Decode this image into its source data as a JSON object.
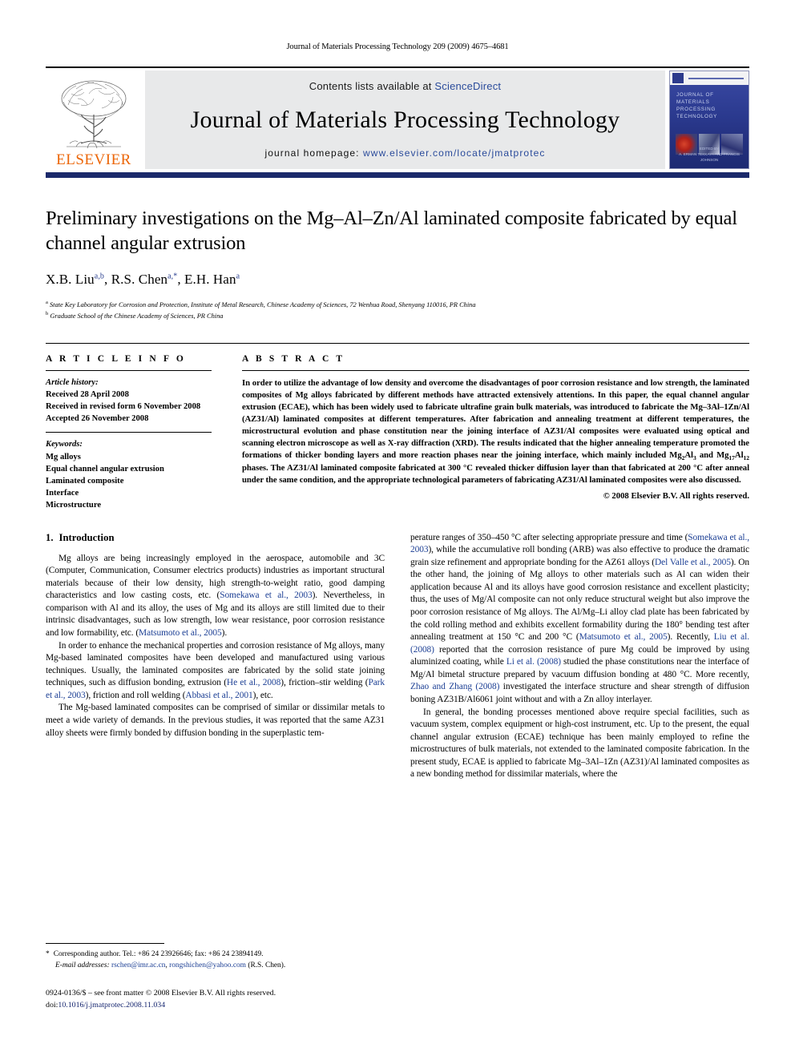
{
  "running_head": "Journal of Materials Processing Technology 209 (2009) 4675–4681",
  "masthead": {
    "publisher": "ELSEVIER",
    "contents_prefix": "Contents lists available at ",
    "contents_link": "ScienceDirect",
    "journal_title": "Journal of Materials Processing Technology",
    "homepage_prefix": "journal homepage:",
    "homepage_url": "www.elsevier.com/locate/jmatprotec",
    "cover": {
      "title_line1": "JOURNAL OF MATERIALS",
      "title_line2": "PROCESSING TECHNOLOGY",
      "footer_line1": "EDITED BY",
      "footer_line2": "A. ERMAN TEKKAYA AND FRANCIS JOHNSON"
    }
  },
  "article": {
    "title": "Preliminary investigations on the Mg–Al–Zn/Al laminated composite fabricated by equal channel angular extrusion",
    "authors": [
      {
        "name": "X.B. Liu",
        "sup": "a,b"
      },
      {
        "name": "R.S. Chen",
        "sup": "a,*"
      },
      {
        "name": "E.H. Han",
        "sup": "a"
      }
    ],
    "affiliations": [
      {
        "mark": "a",
        "text": "State Key Laboratory for Corrosion and Protection, Institute of Metal Research, Chinese Academy of Sciences, 72 Wenhua Road, Shenyang 110016, PR China"
      },
      {
        "mark": "b",
        "text": "Graduate School of the Chinese Academy of Sciences, PR China"
      }
    ]
  },
  "article_info": {
    "heading": "A R T I C L E   I N F O",
    "history_label": "Article history:",
    "history": [
      "Received 28 April 2008",
      "Received in revised form 6 November 2008",
      "Accepted 26 November 2008"
    ],
    "keywords_label": "Keywords:",
    "keywords": [
      "Mg alloys",
      "Equal channel angular extrusion",
      "Laminated composite",
      "Interface",
      "Microstructure"
    ]
  },
  "abstract": {
    "heading": "A B S T R A C T",
    "text_part1": "In order to utilize the advantage of low density and overcome the disadvantages of poor corrosion resistance and low strength, the laminated composites of Mg alloys fabricated by different methods have attracted extensively attentions. In this paper, the equal channel angular extrusion (ECAE), which has been widely used to fabricate ultrafine grain bulk materials, was introduced to fabricate the Mg–3Al–1Zn/Al (AZ31/Al) laminated composites at different temperatures. After fabrication and annealing treatment at different temperatures, the microstructural evolution and phase constitution near the joining interface of AZ31/Al composites were evaluated using optical and scanning electron microscope as well as X-ray diffraction (XRD). The results indicated that the higher annealing temperature promoted the formations of thicker bonding layers and more reaction phases near the joining interface, which mainly included ",
    "formula1_base": "Mg",
    "formula1_sub1": "2",
    "formula1_mid": "Al",
    "formula1_sub2": "3",
    "text_mid": " and ",
    "formula2_base": "Mg",
    "formula2_sub1": "17",
    "formula2_mid": "Al",
    "formula2_sub2": "12",
    "text_part2": " phases. The AZ31/Al laminated composite fabricated at 300 °C revealed thicker diffusion layer than that fabricated at 200 °C after anneal under the same condition, and the appropriate technological parameters of fabricating AZ31/Al laminated composites were also discussed.",
    "copyright": "© 2008 Elsevier B.V. All rights reserved."
  },
  "body": {
    "section_number": "1.",
    "section_title": "Introduction",
    "left_paragraphs": [
      {
        "segments": [
          {
            "t": "Mg alloys are being increasingly employed in the aerospace, automobile and 3C (Computer, Communication, Consumer electrics products) industries as important structural materials because of their low density, high strength-to-weight ratio, good damping characteristics and low casting costs, etc. ("
          },
          {
            "t": "Somekawa et al., 2003",
            "r": true
          },
          {
            "t": "). Nevertheless, in comparison with Al and its alloy, the uses of Mg and its alloys are still limited due to their intrinsic disadvantages, such as low strength, low wear resistance, poor corrosion resistance and low formability, etc. ("
          },
          {
            "t": "Matsumoto et al., 2005",
            "r": true
          },
          {
            "t": ")."
          }
        ]
      },
      {
        "segments": [
          {
            "t": "In order to enhance the mechanical properties and corrosion resistance of Mg alloys, many Mg-based laminated composites have been developed and manufactured using various techniques. Usually, the laminated composites are fabricated by the solid state joining techniques, such as diffusion bonding, extrusion ("
          },
          {
            "t": "He et al., 2008",
            "r": true
          },
          {
            "t": "), friction–stir welding ("
          },
          {
            "t": "Park et al., 2003",
            "r": true
          },
          {
            "t": "), friction and roll welding ("
          },
          {
            "t": "Abbasi et al., 2001",
            "r": true
          },
          {
            "t": "), etc."
          }
        ]
      },
      {
        "segments": [
          {
            "t": "The Mg-based laminated composites can be comprised of similar or dissimilar metals to meet a wide variety of demands. In the previous studies, it was reported that the same AZ31 alloy sheets were firmly bonded by diffusion bonding in the superplastic tem-"
          }
        ]
      }
    ],
    "right_paragraphs": [
      {
        "segments": [
          {
            "t": "perature ranges of 350–450 °C after selecting appropriate pressure and time ("
          },
          {
            "t": "Somekawa et al., 2003",
            "r": true
          },
          {
            "t": "), while the accumulative roll bonding (ARB) was also effective to produce the dramatic grain size refinement and appropriate bonding for the AZ61 alloys ("
          },
          {
            "t": "Del Valle et al., 2005",
            "r": true
          },
          {
            "t": "). On the other hand, the joining of Mg alloys to other materials such as Al can widen their application because Al and its alloys have good corrosion resistance and excellent plasticity; thus, the uses of Mg/Al composite can not only reduce structural weight but also improve the poor corrosion resistance of Mg alloys. The Al/Mg–Li alloy clad plate has been fabricated by the cold rolling method and exhibits excellent formability during the 180° bending test after annealing treatment at 150 °C and 200 °C ("
          },
          {
            "t": "Matsumoto et al., 2005",
            "r": true
          },
          {
            "t": "). Recently, "
          },
          {
            "t": "Liu et al. (2008)",
            "r": true
          },
          {
            "t": " reported that the corrosion resistance of pure Mg could be improved by using aluminized coating, while "
          },
          {
            "t": "Li et al. (2008)",
            "r": true
          },
          {
            "t": " studied the phase constitutions near the interface of Mg/Al bimetal structure prepared by vacuum diffusion bonding at 480 °C. More recently, "
          },
          {
            "t": "Zhao and Zhang (2008)",
            "r": true
          },
          {
            "t": " investigated the interface structure and shear strength of diffusion boning AZ31B/Al6061 joint without and with a Zn alloy interlayer."
          }
        ]
      },
      {
        "segments": [
          {
            "t": "In general, the bonding processes mentioned above require special facilities, such as vacuum system, complex equipment or high-cost instrument, etc. Up to the present, the equal channel angular extrusion (ECAE) technique has been mainly employed to refine the microstructures of bulk materials, not extended to the laminated composite fabrication. In the present study, ECAE is applied to fabricate Mg–3Al–1Zn (AZ31)/Al laminated composites as a new bonding method for dissimilar materials, where the"
          }
        ]
      }
    ]
  },
  "footnote": {
    "star": "*",
    "corresponding": "Corresponding author. Tel.: +86 24 23926646; fax: +86 24 23894149.",
    "email_label": "E-mail addresses:",
    "email1": "rschen@imr.ac.cn",
    "email_sep": ", ",
    "email2": "rongshichen@yahoo.com",
    "email_suffix": " (R.S. Chen)."
  },
  "footer": {
    "issn": "0924-0136/$ – see front matter © 2008 Elsevier B.V. All rights reserved.",
    "doi_label": "doi:",
    "doi": "10.1016/j.jmatprotec.2008.11.034"
  },
  "colors": {
    "link": "#2a4b9b",
    "reference": "#1c3f94",
    "elsevier_orange": "#ec6608",
    "masthead_rule": "#1b2a6b",
    "banner_bg": "#e8e9ea"
  }
}
